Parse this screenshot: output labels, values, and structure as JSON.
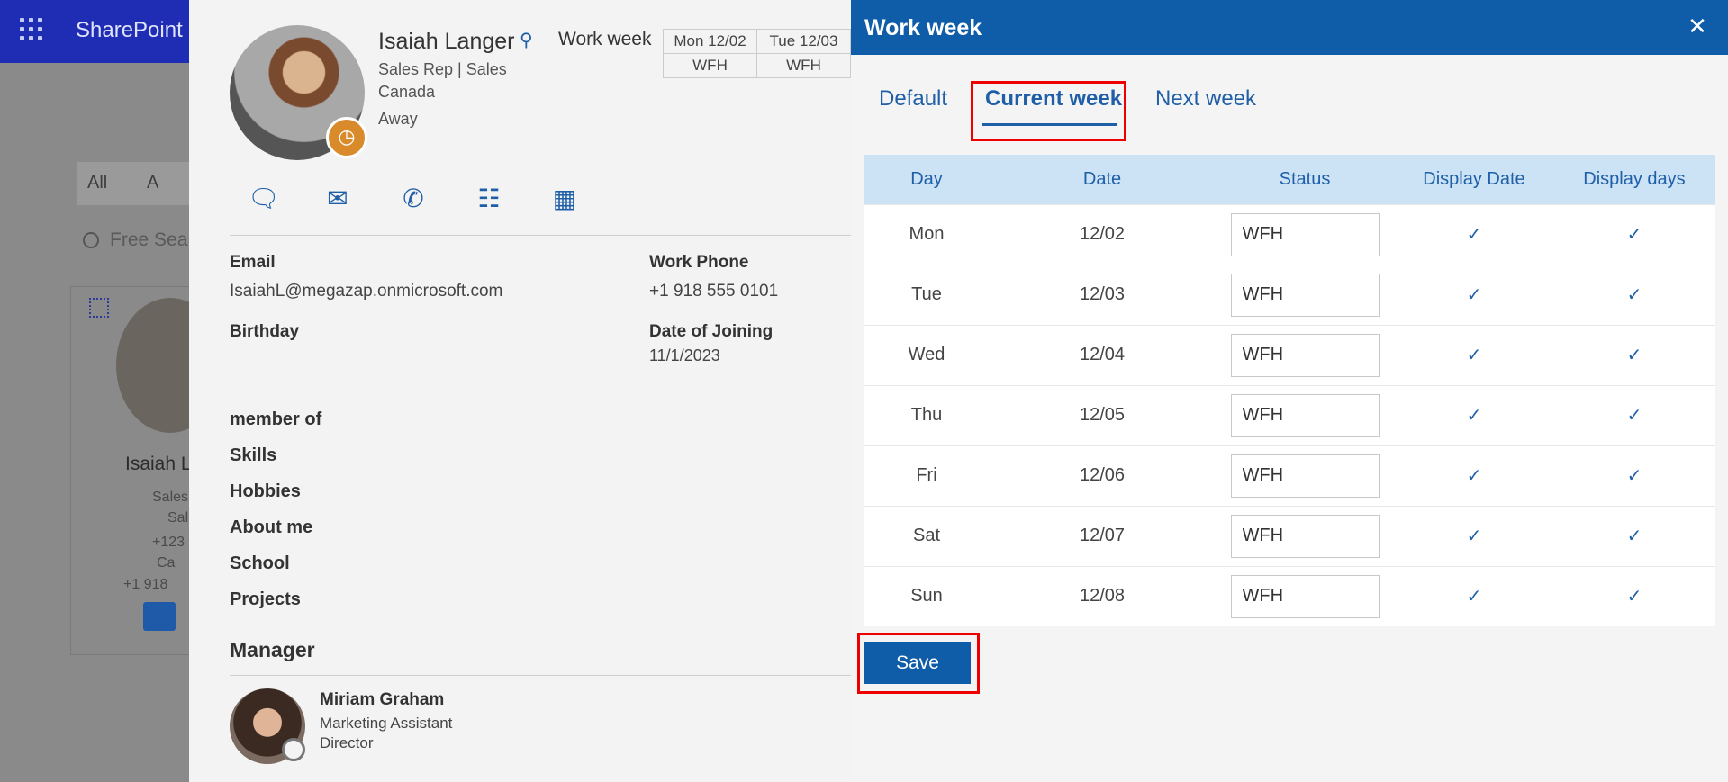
{
  "app": {
    "title": "SharePoint"
  },
  "background": {
    "filter_tabs": [
      "All",
      "A"
    ],
    "search_placeholder": "Free Sea",
    "card_name": "Isaiah L",
    "card_lines": [
      "Sales",
      "Sal",
      "+123",
      "Ca",
      "+1 918"
    ]
  },
  "profile": {
    "name": "Isaiah Langer",
    "role": "Sales Rep | Sales",
    "country": "Canada",
    "presence": "Away",
    "work_week_label": "Work week",
    "mini_week": [
      {
        "day": "Mon 12/02",
        "status": "WFH"
      },
      {
        "day": "Tue 12/03",
        "status": "WFH"
      }
    ],
    "email_label": "Email",
    "email": "IsaiahL@megazap.onmicrosoft.com",
    "work_phone_label": "Work Phone",
    "work_phone": "+1 918 555 0101",
    "birthday_label": "Birthday",
    "joining_label": "Date of Joining",
    "joining_date": "11/1/2023",
    "sections": [
      "member of",
      "Skills",
      "Hobbies",
      "About me",
      "School",
      "Projects"
    ],
    "manager_label": "Manager",
    "manager": {
      "name": "Miriam Graham",
      "title": "Marketing Assistant",
      "role": "Director"
    }
  },
  "dialog": {
    "title": "Work week",
    "tabs": [
      "Default",
      "Current week",
      "Next week"
    ],
    "active_tab": "Current week",
    "columns": [
      "Day",
      "Date",
      "Status",
      "Display Date",
      "Display days"
    ],
    "rows": [
      {
        "day": "Mon",
        "date": "12/02",
        "status": "WFH",
        "display_date": true,
        "display_days": true
      },
      {
        "day": "Tue",
        "date": "12/03",
        "status": "WFH",
        "display_date": true,
        "display_days": true
      },
      {
        "day": "Wed",
        "date": "12/04",
        "status": "WFH",
        "display_date": true,
        "display_days": true
      },
      {
        "day": "Thu",
        "date": "12/05",
        "status": "WFH",
        "display_date": true,
        "display_days": true
      },
      {
        "day": "Fri",
        "date": "12/06",
        "status": "WFH",
        "display_date": true,
        "display_days": true
      },
      {
        "day": "Sat",
        "date": "12/07",
        "status": "WFH",
        "display_date": true,
        "display_days": true
      },
      {
        "day": "Sun",
        "date": "12/08",
        "status": "WFH",
        "display_date": true,
        "display_days": true
      }
    ],
    "save_label": "Save"
  },
  "colors": {
    "brand": "#0f5ca8",
    "highlight": "#e00000",
    "header_bg": "#cce2f5"
  }
}
